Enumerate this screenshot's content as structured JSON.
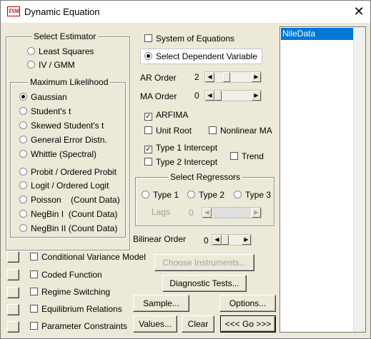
{
  "window": {
    "title": "Dynamic Equation",
    "icon_text": "TSM",
    "close_glyph": "✕"
  },
  "estimator": {
    "legend": "Select Estimator",
    "options": [
      {
        "label": "Least Squares",
        "selected": false
      },
      {
        "label": "IV / GMM",
        "selected": false
      }
    ]
  },
  "ml": {
    "legend": "Maximum Likelihood",
    "options": [
      {
        "label": "Gaussian",
        "selected": true
      },
      {
        "label": "Student's t",
        "selected": false
      },
      {
        "label": "Skewed Student's t",
        "selected": false
      },
      {
        "label": "General Error Distn.",
        "selected": false
      },
      {
        "label": "Whittle (Spectral)",
        "selected": false
      },
      {
        "label": "Probit / Ordered Probit",
        "selected": false
      },
      {
        "label": "Logit / Ordered Logit",
        "selected": false
      },
      {
        "label": "Poisson    (Count Data)",
        "selected": false
      },
      {
        "label": "NegBin I  (Count Data)",
        "selected": false
      },
      {
        "label": "NegBin II (Count Data)",
        "selected": false
      }
    ]
  },
  "system_of_equations": {
    "label": "System of Equations",
    "checked": false
  },
  "dependent_variable": {
    "label": "Select Dependent Variable",
    "selected": true
  },
  "ar_order": {
    "label": "AR Order",
    "value": "2"
  },
  "ma_order": {
    "label": "MA Order",
    "value": "0"
  },
  "checks": {
    "arfima": {
      "label": "ARFIMA",
      "checked": true
    },
    "unit_root": {
      "label": "Unit Root",
      "checked": false
    },
    "nonlinear_ma": {
      "label": "Nonlinear MA",
      "checked": false
    },
    "type1_intercept": {
      "label": "Type 1 Intercept",
      "checked": true
    },
    "type2_intercept": {
      "label": "Type 2 Intercept",
      "checked": false
    },
    "trend": {
      "label": "Trend",
      "checked": false
    }
  },
  "regressors": {
    "legend": "Select Regressors",
    "options": [
      {
        "label": "Type 1",
        "selected": false
      },
      {
        "label": "Type 2",
        "selected": false
      },
      {
        "label": "Type 3",
        "selected": false
      }
    ],
    "lags_label": "Lags",
    "lags_value": "0"
  },
  "bilinear_order": {
    "label": "Bilinear Order",
    "value": "0"
  },
  "bottom_checks": [
    {
      "label": "Conditional Variance Model",
      "checked": false
    },
    {
      "label": "Coded Function",
      "checked": false
    },
    {
      "label": "Regime Switching",
      "checked": false
    },
    {
      "label": "Equilibrium Relations",
      "checked": false
    },
    {
      "label": "Parameter Constraints",
      "checked": false
    }
  ],
  "buttons": {
    "choose_instruments": "Choose Instruments...",
    "diagnostic_tests": "Diagnostic Tests...",
    "sample": "Sample...",
    "options": "Options...",
    "values": "Values...",
    "clear": "Clear",
    "go": "<<< Go >>>"
  },
  "variables_list": [
    "NileData"
  ],
  "selected_variable": "NileData",
  "colors": {
    "dialog_bg": "#ece9d8",
    "selection": "#0078d7"
  }
}
